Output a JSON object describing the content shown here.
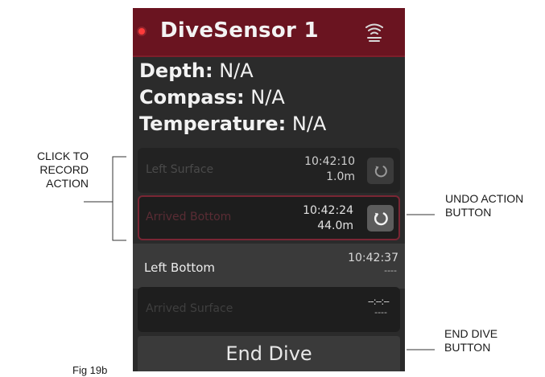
{
  "header": {
    "device_name": "DiveSensor 1",
    "status_color": "#ff3b3b",
    "signal_icon": "wifi-signal-icon"
  },
  "readouts": [
    {
      "label": "Depth:",
      "value": "N/A"
    },
    {
      "label": "Compass:",
      "value": "N/A"
    },
    {
      "label": "Temperature:",
      "value": "N/A"
    }
  ],
  "actions": [
    {
      "label": "Left Surface",
      "time": "10:42:10",
      "depth": "1.0m",
      "icon": "undo-icon"
    },
    {
      "label": "Arrived Bottom",
      "time": "10:42:24",
      "depth": "44.0m",
      "icon": "undo-icon"
    },
    {
      "label": "Left Bottom",
      "time": "10:42:37",
      "depth": "----"
    },
    {
      "label": "Arrived Surface",
      "time": "--:--:--",
      "depth": "----"
    }
  ],
  "end_dive_label": "End Dive",
  "annotations": {
    "click_to_record": [
      "CLICK TO",
      "RECORD",
      "ACTION"
    ],
    "undo_button": [
      "UNDO ACTION",
      "BUTTON"
    ],
    "end_dive_button": [
      "END DIVE",
      "BUTTON"
    ],
    "figure": "Fig 19b"
  },
  "colors": {
    "header_bg": "#6a1420",
    "screen_bg": "#2b2b2b",
    "selected_border": "#7a2634"
  }
}
